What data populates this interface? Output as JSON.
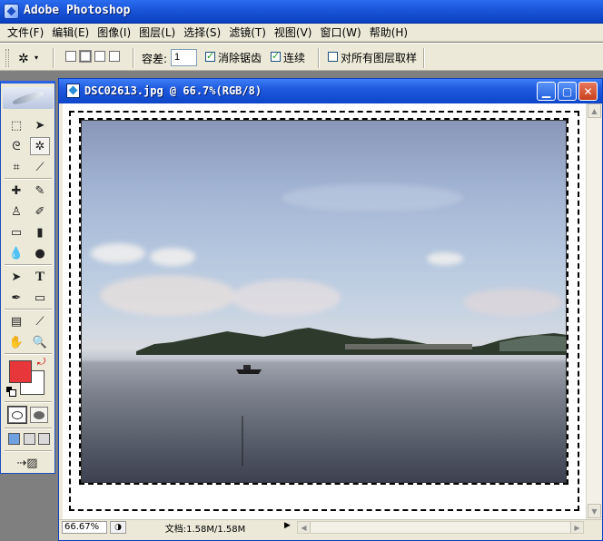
{
  "app": {
    "title": "Adobe Photoshop"
  },
  "menu": [
    "文件(F)",
    "编辑(E)",
    "图像(I)",
    "图层(L)",
    "选择(S)",
    "滤镜(T)",
    "视图(V)",
    "窗口(W)",
    "帮助(H)"
  ],
  "options": {
    "tolerance_label": "容差:",
    "tolerance_value": "1",
    "anti_alias_label": "消除锯齿",
    "anti_alias_checked": true,
    "contiguous_label": "连续",
    "contiguous_checked": true,
    "sample_all_label": "对所有图层取样",
    "sample_all_checked": false
  },
  "toolbox": {
    "foreground_color": "#e8373b",
    "background_color": "#ffffff",
    "active_tool": "magic-wand"
  },
  "document": {
    "title": "DSC02613.jpg @ 66.7%(RGB/8)",
    "zoom": "66.67%",
    "doc_info": "文档:1.58M/1.58M"
  }
}
